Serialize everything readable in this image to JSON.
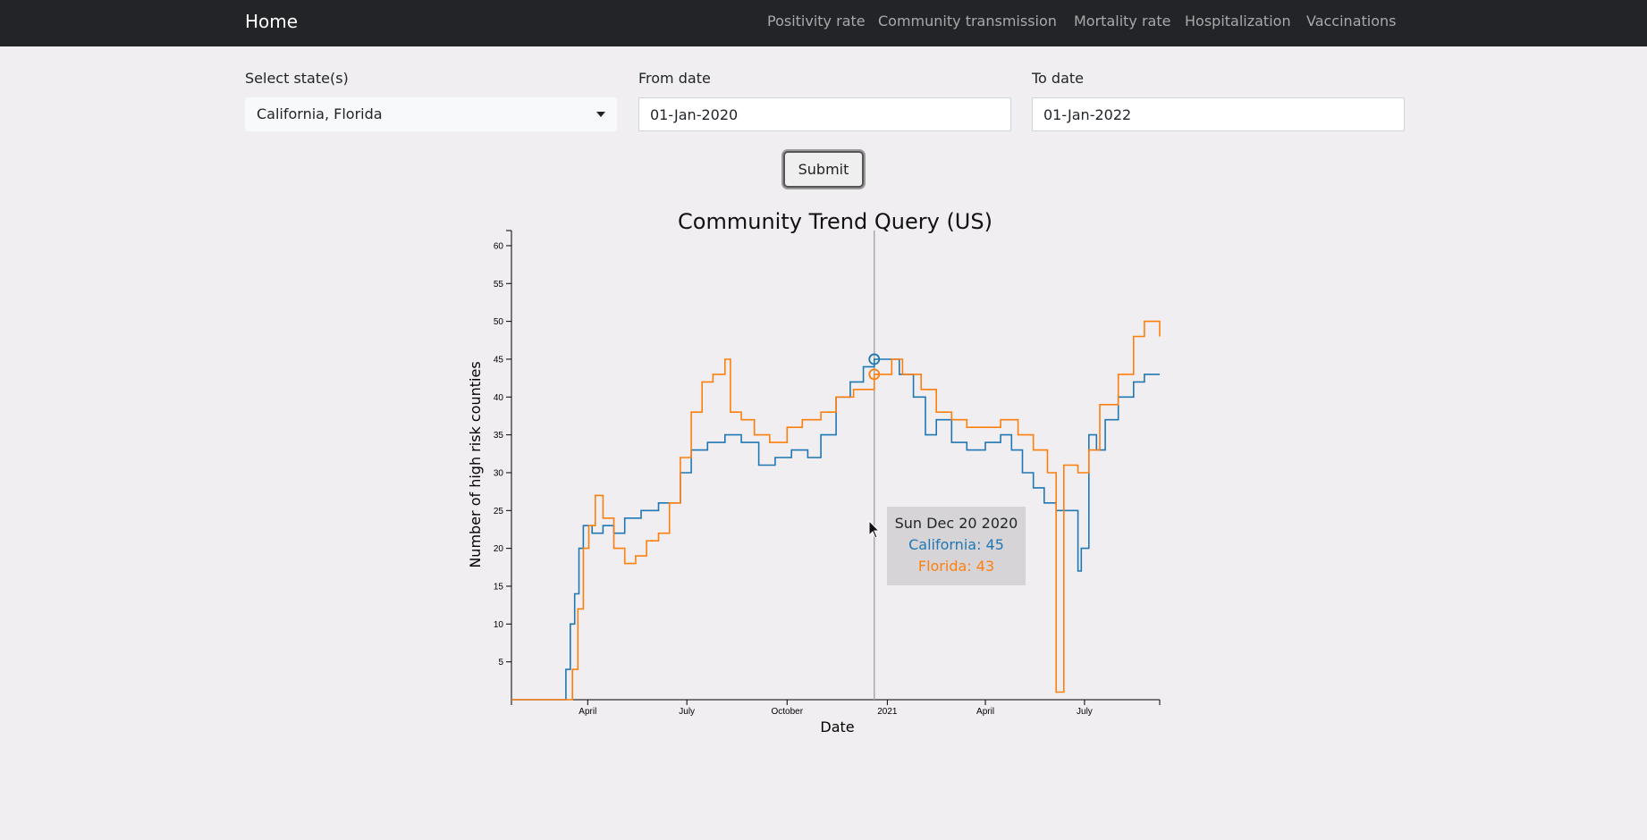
{
  "navbar": {
    "brand": "Home",
    "links": [
      "Positivity rate",
      "Community transmission",
      "Mortality rate",
      "Hospitalization",
      "Vaccinations"
    ]
  },
  "form": {
    "state_label": "Select state(s)",
    "state_value": "California, Florida",
    "from_label": "From date",
    "from_value": "01-Jan-2020",
    "to_label": "To date",
    "to_value": "01-Jan-2022",
    "submit_label": "Submit"
  },
  "tooltip": {
    "date": "Sun Dec 20 2020",
    "california": "California: 45",
    "florida": "Florida: 43"
  },
  "colors": {
    "california": "#1f77b4",
    "florida": "#ff7f0e"
  },
  "chart_data": {
    "type": "line",
    "title": "Community Trend Query (US)",
    "xlabel": "Date",
    "ylabel": "Number of high risk counties",
    "x_tick_labels": [
      "April",
      "July",
      "October",
      "2021",
      "April",
      "July"
    ],
    "y_ticks": [
      5,
      10,
      15,
      20,
      25,
      30,
      35,
      40,
      45,
      50,
      55,
      60
    ],
    "ylim": [
      0,
      62
    ],
    "xlim": [
      "2020-01-22",
      "2021-09-08"
    ],
    "hover_date": "2020-12-20",
    "series": [
      {
        "name": "California",
        "color": "#1f77b4",
        "points": [
          [
            "2020-01-22",
            0
          ],
          [
            "2020-03-07",
            0
          ],
          [
            "2020-03-12",
            4
          ],
          [
            "2020-03-16",
            10
          ],
          [
            "2020-03-20",
            14
          ],
          [
            "2020-03-24",
            20
          ],
          [
            "2020-03-28",
            23
          ],
          [
            "2020-04-05",
            22
          ],
          [
            "2020-04-15",
            23
          ],
          [
            "2020-04-25",
            22
          ],
          [
            "2020-05-05",
            24
          ],
          [
            "2020-05-20",
            25
          ],
          [
            "2020-06-05",
            26
          ],
          [
            "2020-06-15",
            26
          ],
          [
            "2020-06-25",
            30
          ],
          [
            "2020-07-05",
            33
          ],
          [
            "2020-07-20",
            34
          ],
          [
            "2020-08-05",
            35
          ],
          [
            "2020-08-20",
            34
          ],
          [
            "2020-09-05",
            31
          ],
          [
            "2020-09-20",
            32
          ],
          [
            "2020-10-05",
            33
          ],
          [
            "2020-10-20",
            32
          ],
          [
            "2020-11-01",
            35
          ],
          [
            "2020-11-15",
            40
          ],
          [
            "2020-11-28",
            42
          ],
          [
            "2020-12-10",
            44
          ],
          [
            "2020-12-20",
            45
          ],
          [
            "2021-01-01",
            45
          ],
          [
            "2021-01-12",
            43
          ],
          [
            "2021-01-25",
            40
          ],
          [
            "2021-02-05",
            35
          ],
          [
            "2021-02-15",
            37
          ],
          [
            "2021-03-01",
            34
          ],
          [
            "2021-03-15",
            33
          ],
          [
            "2021-04-01",
            34
          ],
          [
            "2021-04-15",
            35
          ],
          [
            "2021-04-25",
            33
          ],
          [
            "2021-05-05",
            30
          ],
          [
            "2021-05-15",
            28
          ],
          [
            "2021-05-25",
            26
          ],
          [
            "2021-06-05",
            25
          ],
          [
            "2021-06-15",
            25
          ],
          [
            "2021-06-25",
            17
          ],
          [
            "2021-06-28",
            20
          ],
          [
            "2021-07-05",
            35
          ],
          [
            "2021-07-12",
            33
          ],
          [
            "2021-07-20",
            37
          ],
          [
            "2021-08-01",
            40
          ],
          [
            "2021-08-15",
            42
          ],
          [
            "2021-08-25",
            43
          ],
          [
            "2021-09-08",
            43
          ]
        ]
      },
      {
        "name": "Florida",
        "color": "#ff7f0e",
        "points": [
          [
            "2020-01-22",
            0
          ],
          [
            "2020-03-14",
            0
          ],
          [
            "2020-03-18",
            4
          ],
          [
            "2020-03-23",
            12
          ],
          [
            "2020-03-28",
            20
          ],
          [
            "2020-04-02",
            23
          ],
          [
            "2020-04-08",
            27
          ],
          [
            "2020-04-15",
            24
          ],
          [
            "2020-04-25",
            20
          ],
          [
            "2020-05-05",
            18
          ],
          [
            "2020-05-15",
            19
          ],
          [
            "2020-05-25",
            21
          ],
          [
            "2020-06-05",
            22
          ],
          [
            "2020-06-15",
            26
          ],
          [
            "2020-06-25",
            32
          ],
          [
            "2020-07-05",
            38
          ],
          [
            "2020-07-15",
            42
          ],
          [
            "2020-07-25",
            43
          ],
          [
            "2020-08-05",
            45
          ],
          [
            "2020-08-10",
            38
          ],
          [
            "2020-08-20",
            37
          ],
          [
            "2020-09-01",
            35
          ],
          [
            "2020-09-15",
            34
          ],
          [
            "2020-10-01",
            36
          ],
          [
            "2020-10-15",
            37
          ],
          [
            "2020-11-01",
            38
          ],
          [
            "2020-11-15",
            40
          ],
          [
            "2020-12-01",
            41
          ],
          [
            "2020-12-20",
            43
          ],
          [
            "2021-01-05",
            45
          ],
          [
            "2021-01-15",
            43
          ],
          [
            "2021-02-01",
            41
          ],
          [
            "2021-02-15",
            38
          ],
          [
            "2021-03-01",
            37
          ],
          [
            "2021-03-15",
            36
          ],
          [
            "2021-04-01",
            36
          ],
          [
            "2021-04-15",
            37
          ],
          [
            "2021-05-01",
            35
          ],
          [
            "2021-05-15",
            33
          ],
          [
            "2021-05-28",
            30
          ],
          [
            "2021-06-05",
            1
          ],
          [
            "2021-06-09",
            1
          ],
          [
            "2021-06-12",
            31
          ],
          [
            "2021-06-25",
            30
          ],
          [
            "2021-07-05",
            33
          ],
          [
            "2021-07-15",
            39
          ],
          [
            "2021-08-01",
            43
          ],
          [
            "2021-08-15",
            48
          ],
          [
            "2021-08-25",
            50
          ],
          [
            "2021-09-08",
            48
          ]
        ]
      }
    ]
  }
}
